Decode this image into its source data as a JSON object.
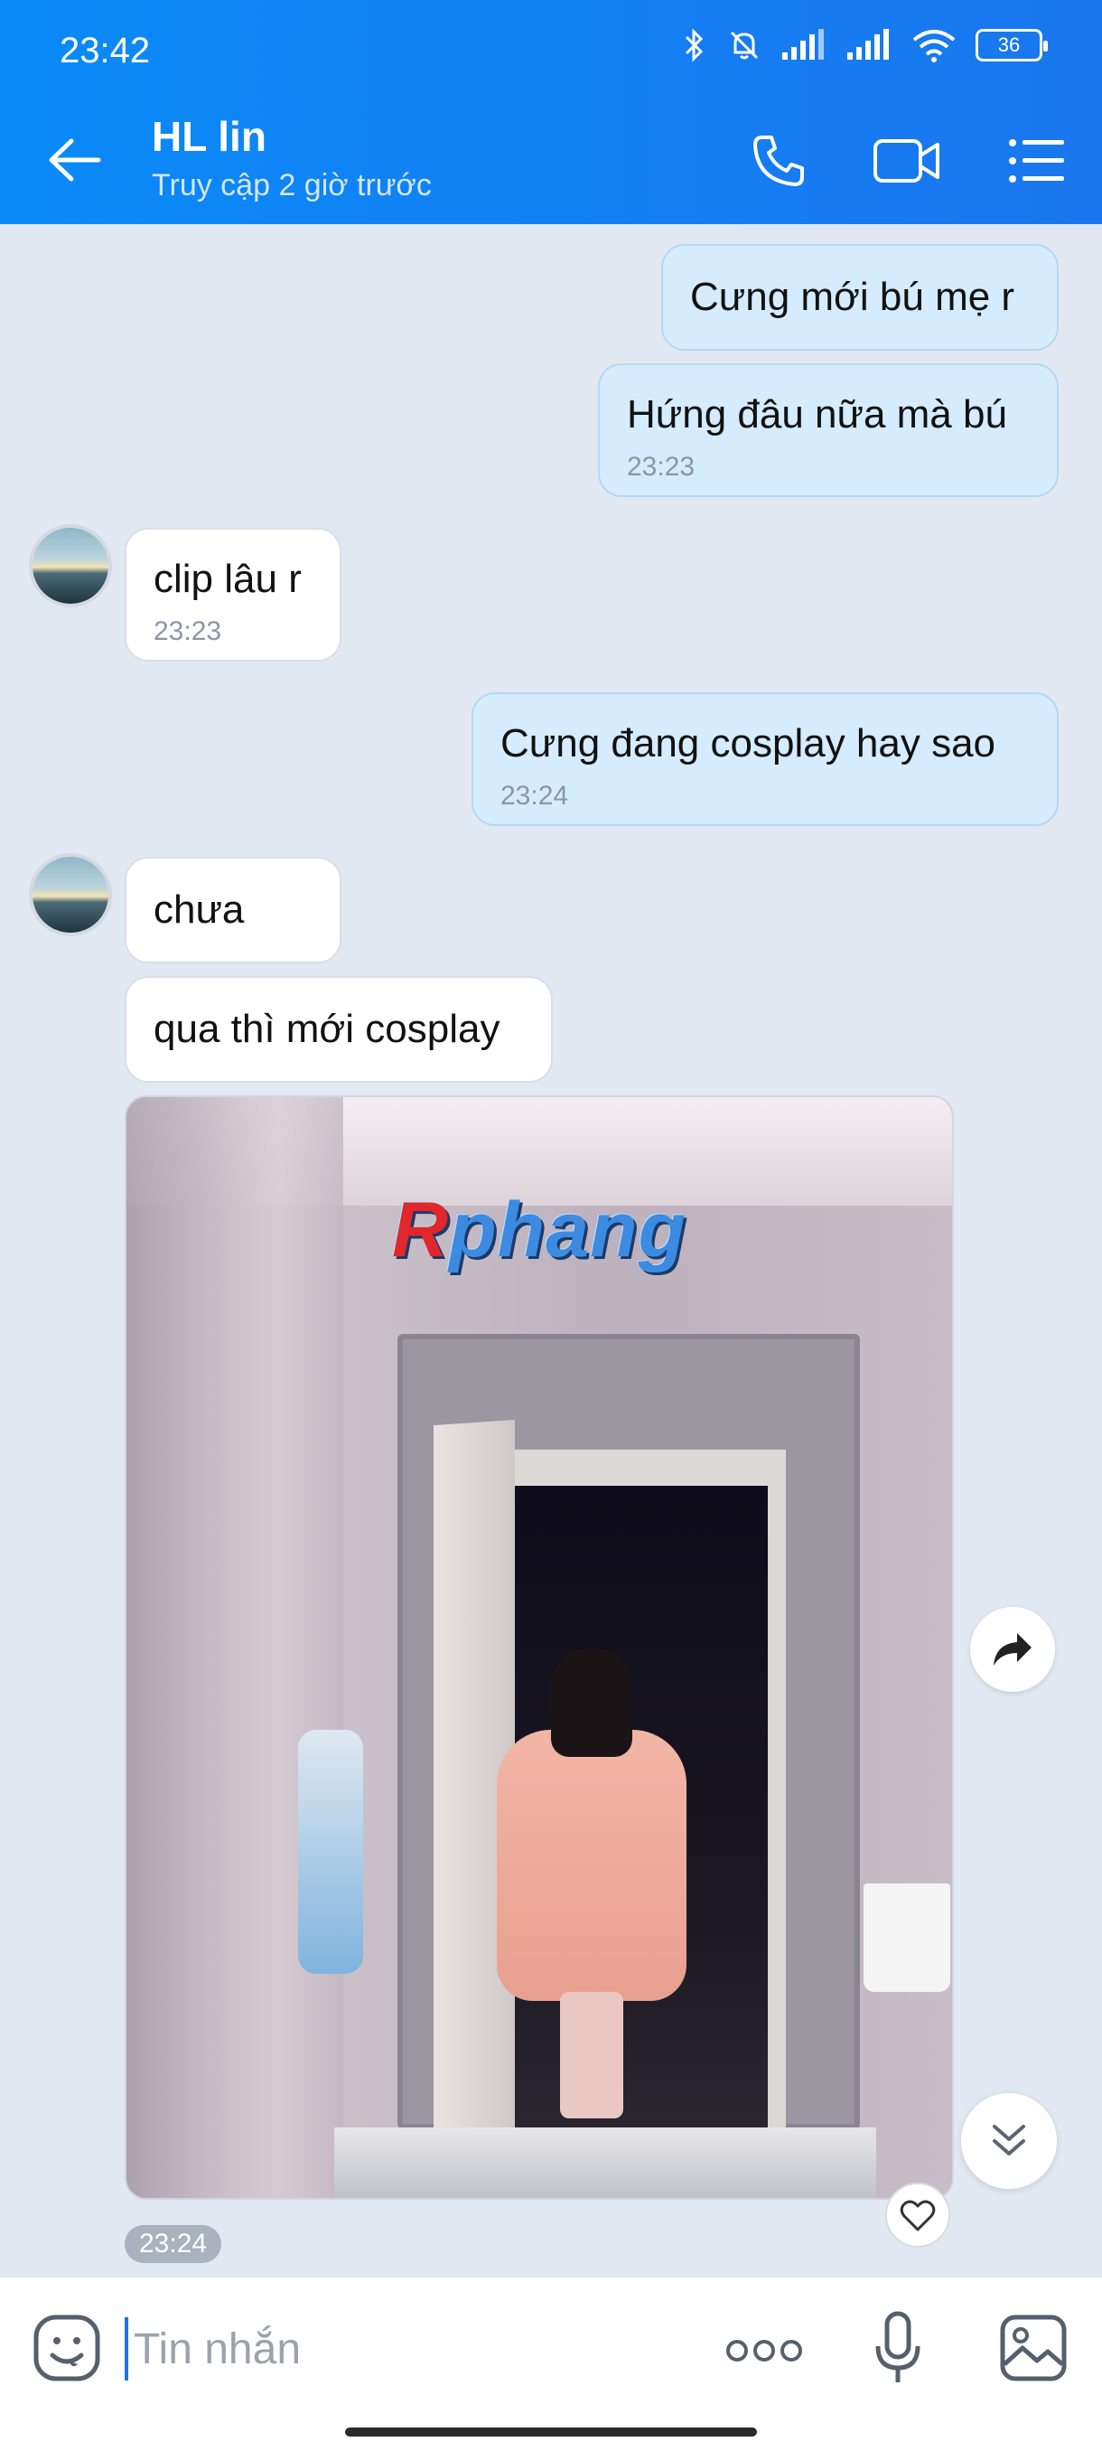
{
  "status_bar": {
    "time": "23:42",
    "battery": "36"
  },
  "header": {
    "name": "HL lin",
    "status": "Truy cập 2 giờ trước"
  },
  "messages": [
    {
      "from": "me",
      "text": "Cưng mới bú mẹ r",
      "time": ""
    },
    {
      "from": "me",
      "text": "Hứng đâu nữa mà bú",
      "time": "23:23"
    },
    {
      "from": "them",
      "text": "clip lâu r",
      "time": "23:23"
    },
    {
      "from": "me",
      "text": "Cưng đang cosplay hay sao",
      "time": "23:24"
    },
    {
      "from": "them",
      "text": "chưa",
      "time": ""
    },
    {
      "from": "them",
      "text": "qua thì mới cosplay",
      "time": ""
    }
  ],
  "photo": {
    "watermark_r": "R",
    "watermark_rest": "phang",
    "time": "23:24"
  },
  "input": {
    "placeholder": "Tin nhắn"
  },
  "colors": {
    "header": "#0a8af8",
    "my_bubble": "#d4ecfd",
    "their_bubble": "#ffffff",
    "background": "#e2e8f1"
  },
  "icons": [
    "back-arrow-icon",
    "phone-icon",
    "video-icon",
    "menu-list-icon",
    "share-arrow-icon",
    "double-chevron-down-icon",
    "heart-icon",
    "emoji-icon",
    "more-dots-icon",
    "mic-icon",
    "gallery-icon"
  ]
}
